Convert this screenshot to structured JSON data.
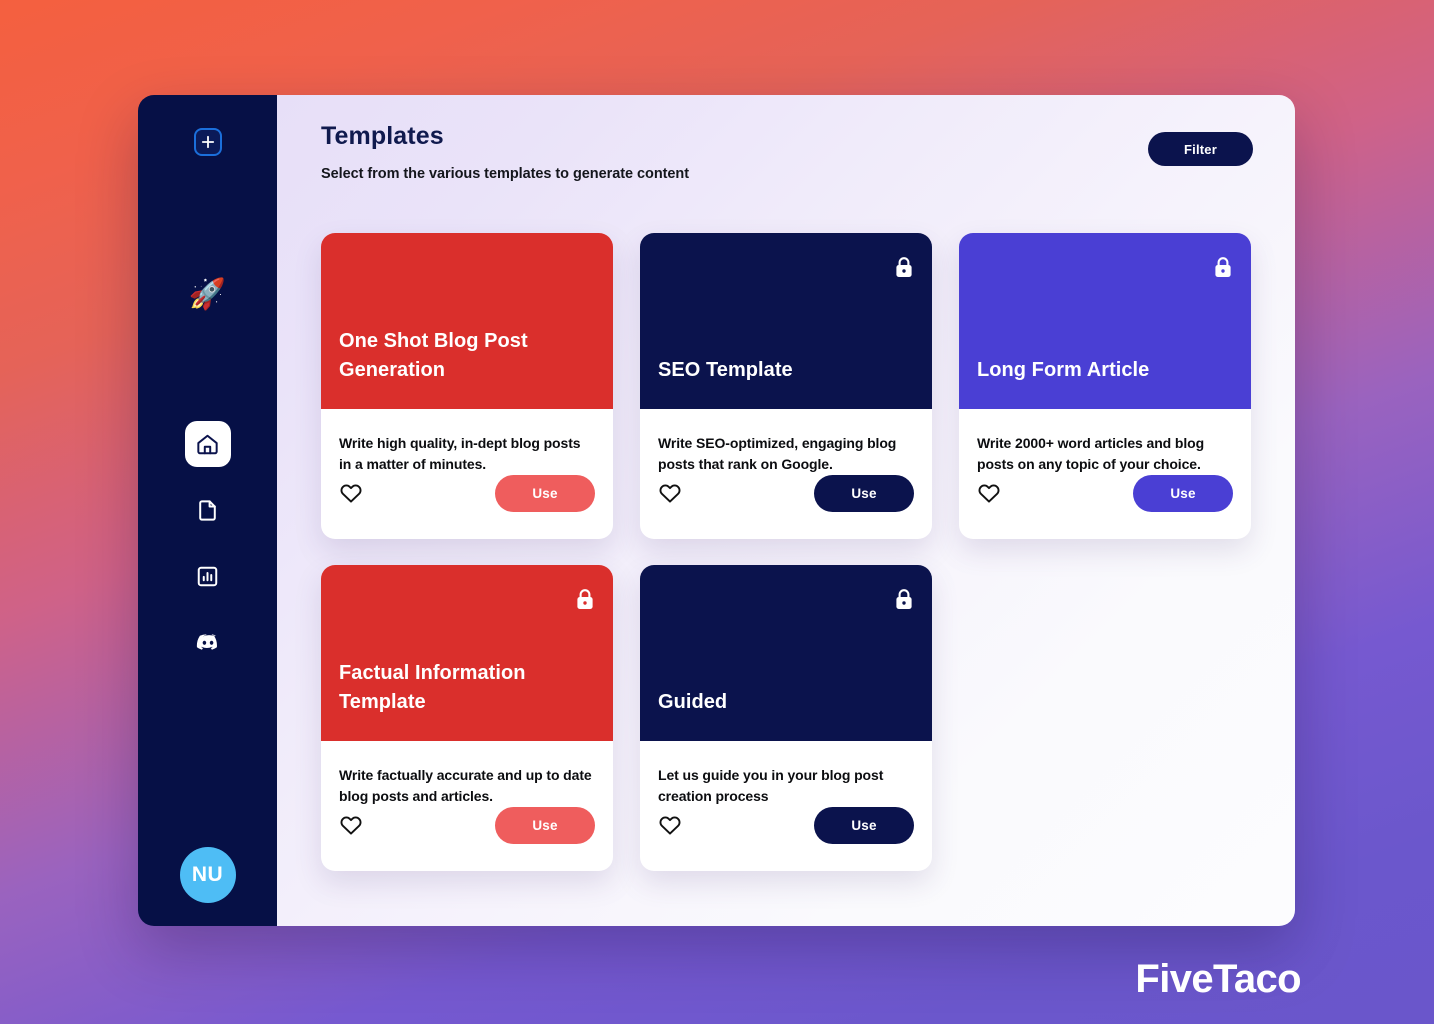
{
  "sidebar": {
    "add_button": {
      "icon": "plus-icon",
      "label": "+"
    },
    "logo": {
      "icon": "rocket-icon",
      "glyph": "🚀"
    },
    "nav_items": [
      {
        "icon": "home-icon",
        "name": "home",
        "active": true
      },
      {
        "icon": "document-icon",
        "name": "documents",
        "active": false
      },
      {
        "icon": "bar-chart-icon",
        "name": "analytics",
        "active": false
      },
      {
        "icon": "discord-icon",
        "name": "discord",
        "active": false
      }
    ],
    "avatar": {
      "initials": "NU",
      "color": "#4ebdf5"
    }
  },
  "header": {
    "title": "Templates",
    "subtitle": "Select from the various templates to generate content",
    "filter_label": "Filter"
  },
  "colors": {
    "navy": "#0b134d",
    "red": "#da2f2c",
    "indigo": "#4a3fd4",
    "salmon": "#ef5d5d",
    "avatar_blue": "#4ebdf5",
    "sidebar_bg": "#061046",
    "title_navy": "#101a4e"
  },
  "templates": [
    {
      "title": "One Shot Blog Post Generation",
      "description": "Write high quality, in-dept blog posts in a matter of minutes.",
      "use_label": "Use",
      "locked": false,
      "header_color": "#da2f2c",
      "button_color": "#ef5d5d"
    },
    {
      "title": "SEO Template",
      "description": "Write SEO-optimized, engaging blog posts that rank on Google.",
      "use_label": "Use",
      "locked": true,
      "header_color": "#0b134d",
      "button_color": "#0b134d"
    },
    {
      "title": "Long Form Article",
      "description": "Write 2000+ word articles and blog posts on any topic of your choice.",
      "use_label": "Use",
      "locked": true,
      "header_color": "#4a3fd4",
      "button_color": "#4a3fd4"
    },
    {
      "title": "Factual Information Template",
      "description": "Write factually accurate and up to date blog posts and articles.",
      "use_label": "Use",
      "locked": true,
      "header_color": "#da2f2c",
      "button_color": "#ef5d5d"
    },
    {
      "title": "Guided",
      "description": "Let us guide you in your blog post creation process",
      "use_label": "Use",
      "locked": true,
      "header_color": "#0b134d",
      "button_color": "#0b134d"
    }
  ],
  "watermark": {
    "text": "FiveTaco"
  }
}
